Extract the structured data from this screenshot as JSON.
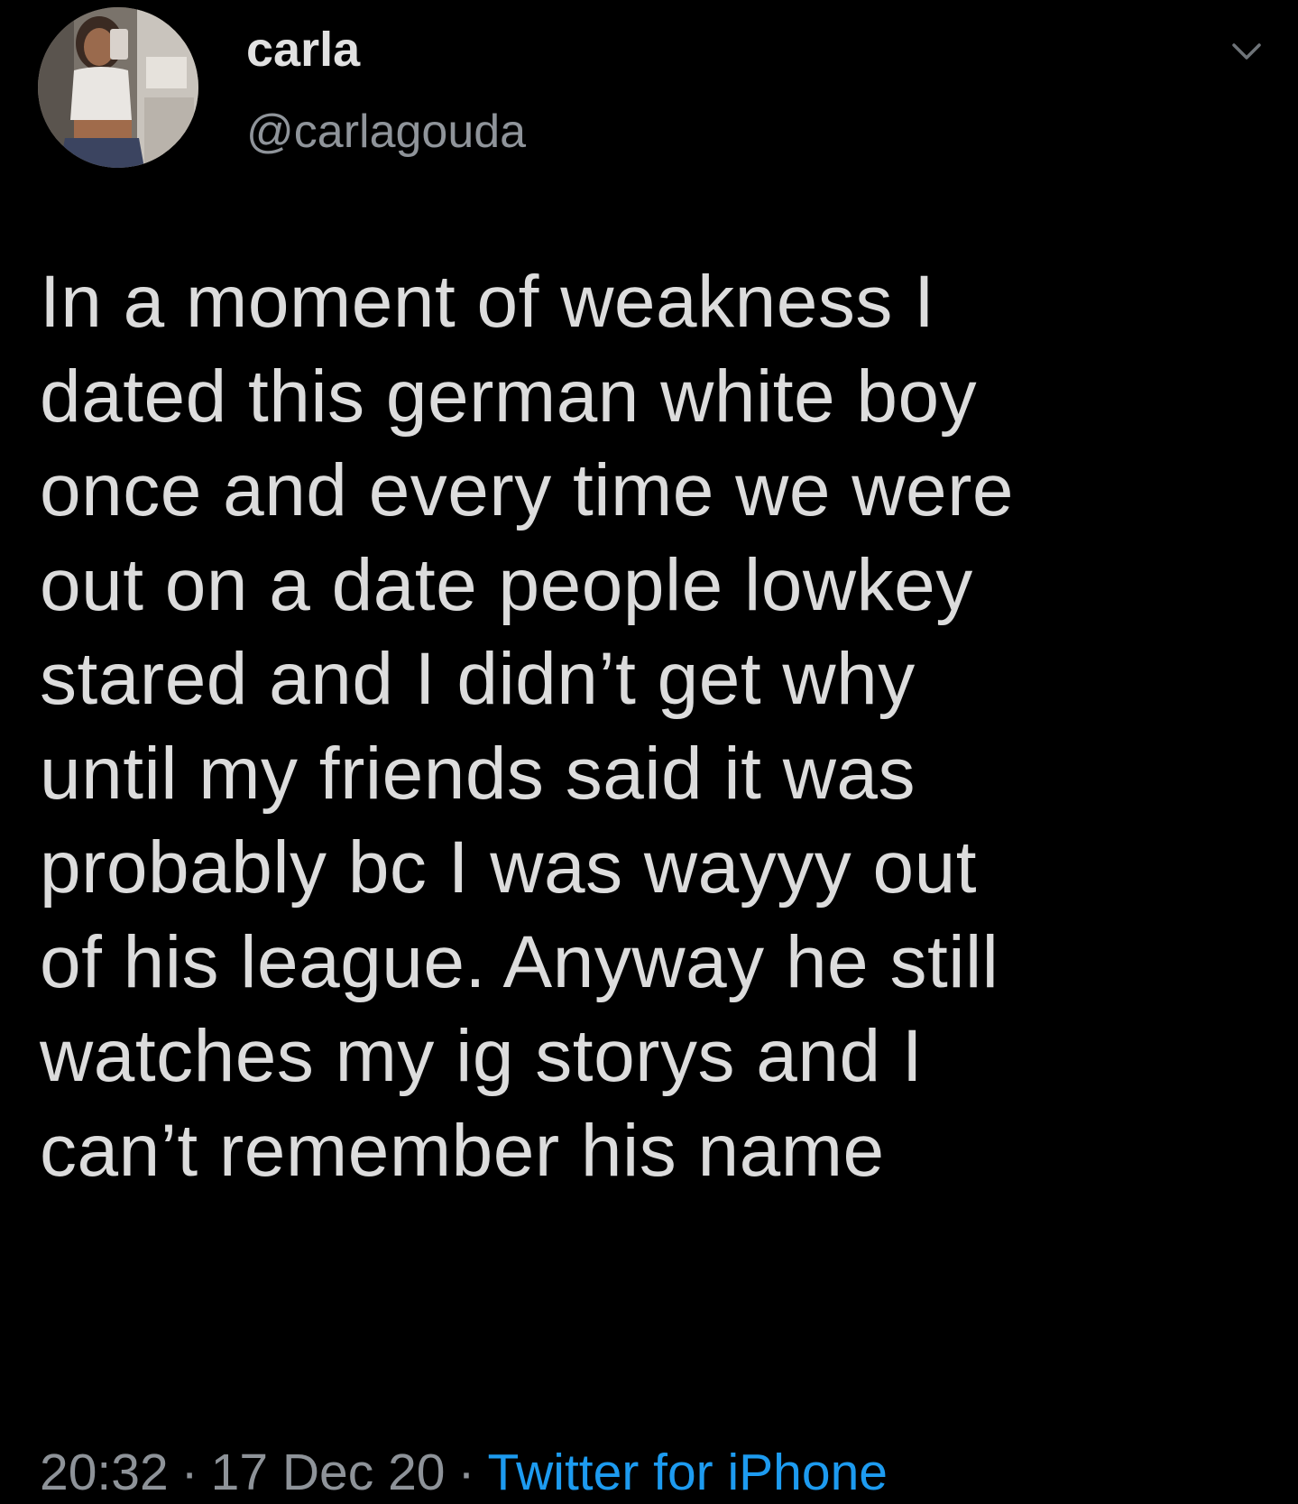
{
  "author": {
    "name": "carla",
    "handle": "@carlagouda",
    "avatar_icon": "profile-photo"
  },
  "menu_icon": "chevron-down-icon",
  "tweet": {
    "text": "In a moment of weakness I\ndated this german white boy\nonce and every time we were\nout on a date people lowkey\nstared and I didn’t get why\nuntil my friends said it was\nprobably bc I was wayyy out\nof his league. Anyway he still\nwatches my ig storys and I\ncan’t remember his name"
  },
  "meta": {
    "time": "20:32",
    "date": "17 Dec 20",
    "separator": "·",
    "source": "Twitter for iPhone"
  },
  "colors": {
    "background": "#000000",
    "text": "#dcdcdc",
    "secondary": "#8e9399",
    "link": "#1d9bf0"
  }
}
